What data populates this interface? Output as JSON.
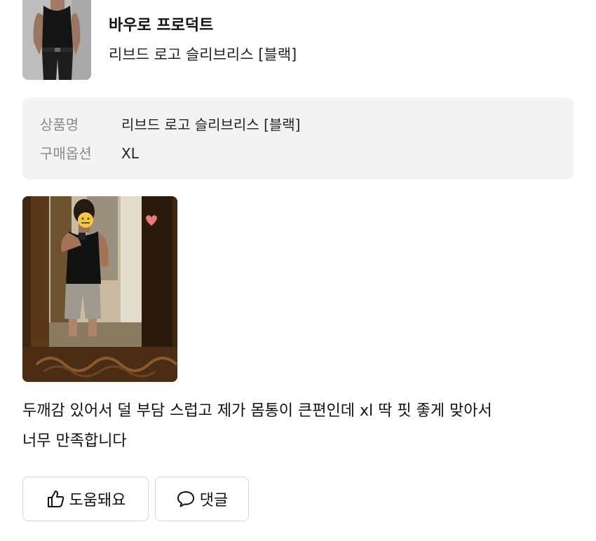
{
  "product": {
    "brand": "바우로 프로덕트",
    "name": "리브드 로고 슬리브리스 [블랙]"
  },
  "options": [
    {
      "label": "상품명",
      "value": "리브드 로고 슬리브리스 [블랙]"
    },
    {
      "label": "구매옵션",
      "value": "XL"
    }
  ],
  "review": {
    "text_line1": "두깨감 있어서 덜 부담 스럽고 제가 몸통이 큰편인데 xl 딱 핏 좋게 맞아서",
    "text_line2": "너무 만족합니다"
  },
  "actions": {
    "helpful_label": "도움돼요",
    "comment_label": "댓글"
  }
}
